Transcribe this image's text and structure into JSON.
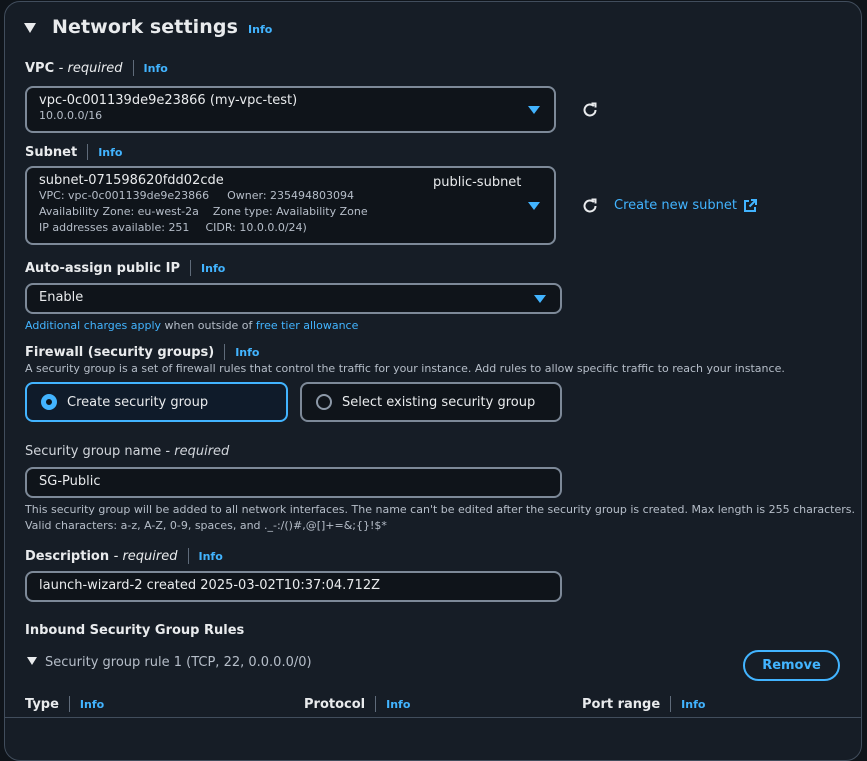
{
  "section": {
    "title": "Network settings",
    "info_label": "Info"
  },
  "vpc": {
    "label": "VPC",
    "required": "- required",
    "info_label": "Info",
    "value": "vpc-0c001139de9e23866 (my-vpc-test)",
    "cidr": "10.0.0.0/16"
  },
  "subnet": {
    "label": "Subnet",
    "info_label": "Info",
    "id": "subnet-071598620fdd02cde",
    "name": "public-subnet",
    "vpc_line": "VPC: vpc-0c001139de9e23866",
    "owner_line": "Owner: 235494803094",
    "az_line": "Availability Zone: eu-west-2a",
    "zone_type_line": "Zone type: Availability Zone",
    "ip_line": "IP addresses available: 251",
    "cidr_line": "CIDR: 10.0.0.0/24)",
    "create_link": "Create new subnet"
  },
  "public_ip": {
    "label": "Auto-assign public IP",
    "info_label": "Info",
    "value": "Enable",
    "note_link1": "Additional charges apply",
    "note_text": " when outside of ",
    "note_link2": "free tier allowance"
  },
  "firewall": {
    "label": "Firewall (security groups)",
    "info_label": "Info",
    "description": "A security group is a set of firewall rules that control the traffic for your instance. Add rules to allow specific traffic to reach your instance.",
    "options": [
      {
        "label": "Create security group",
        "selected": true
      },
      {
        "label": "Select existing security group",
        "selected": false
      }
    ]
  },
  "sg_name": {
    "label": "Security group name",
    "required": "- required",
    "value": "SG-Public",
    "help_line1": "This security group will be added to all network interfaces. The name can't be edited after the security group is created. Max length is 255 characters.",
    "help_line2": "Valid characters: a-z, A-Z, 0-9, spaces, and ._-:/()#,@[]+=&;{}!$*"
  },
  "description": {
    "label": "Description",
    "required": "- required",
    "info_label": "Info",
    "value": "launch-wizard-2 created 2025-03-02T10:37:04.712Z"
  },
  "inbound": {
    "title": "Inbound Security Group Rules",
    "rule_title": "Security group rule 1 (TCP, 22, 0.0.0.0/0)",
    "remove_label": "Remove",
    "columns": [
      {
        "label": "Type",
        "info_label": "Info"
      },
      {
        "label": "Protocol",
        "info_label": "Info"
      },
      {
        "label": "Port range",
        "info_label": "Info"
      }
    ]
  },
  "colors": {
    "accent": "#42b4ff",
    "background": "#161d26",
    "border": "#7d8998"
  }
}
